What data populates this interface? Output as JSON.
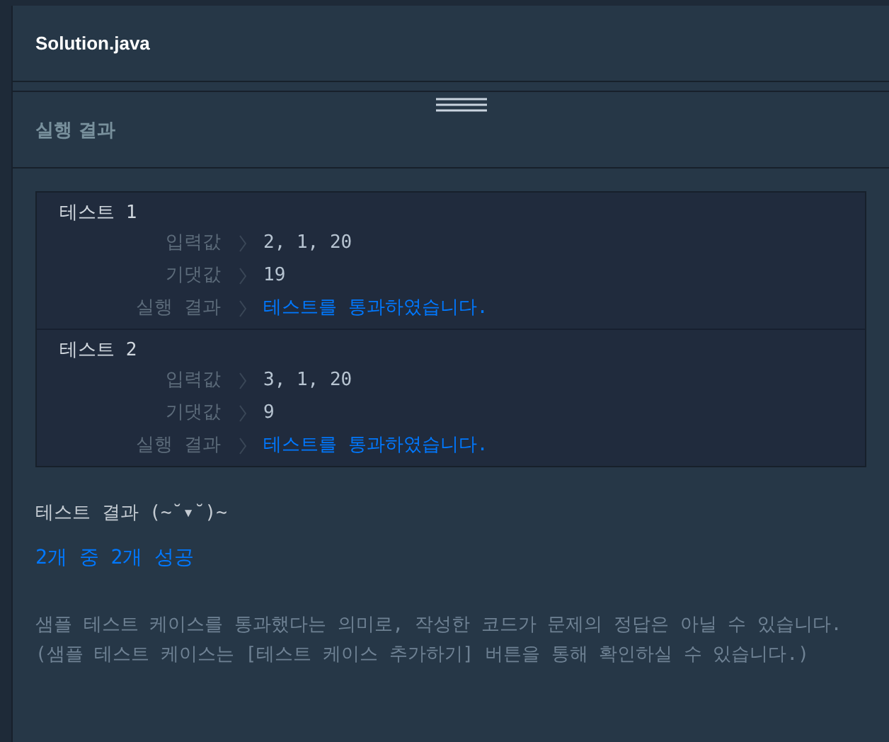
{
  "file_tab": {
    "title": "Solution.java"
  },
  "panel": {
    "title": "실행 결과"
  },
  "tests": [
    {
      "title": "테스트 1",
      "rows": [
        {
          "kind": "value",
          "label": "입력값",
          "value": "2, 1, 20"
        },
        {
          "kind": "value",
          "label": "기댓값",
          "value": "19"
        },
        {
          "kind": "result",
          "label": "실행 결과",
          "value": "테스트를 통과하였습니다.",
          "passed": true
        }
      ]
    },
    {
      "title": "테스트 2",
      "rows": [
        {
          "kind": "value",
          "label": "입력값",
          "value": "3, 1, 20"
        },
        {
          "kind": "value",
          "label": "기댓값",
          "value": "9"
        },
        {
          "kind": "result",
          "label": "실행 결과",
          "value": "테스트를 통과하였습니다.",
          "passed": true
        }
      ]
    }
  ],
  "summary": {
    "title": "테스트 결과 (~˘▾˘)~",
    "score": "2개 중 2개 성공",
    "passed": true,
    "notes": [
      "샘플 테스트 케이스를 통과했다는 의미로, 작성한 코드가 문제의 정답은 아닐 수 있습니다.",
      "(샘플 테스트 케이스는 [테스트 케이스 추가하기] 버튼을 통해 확인하실 수 있습니다.)"
    ]
  }
}
